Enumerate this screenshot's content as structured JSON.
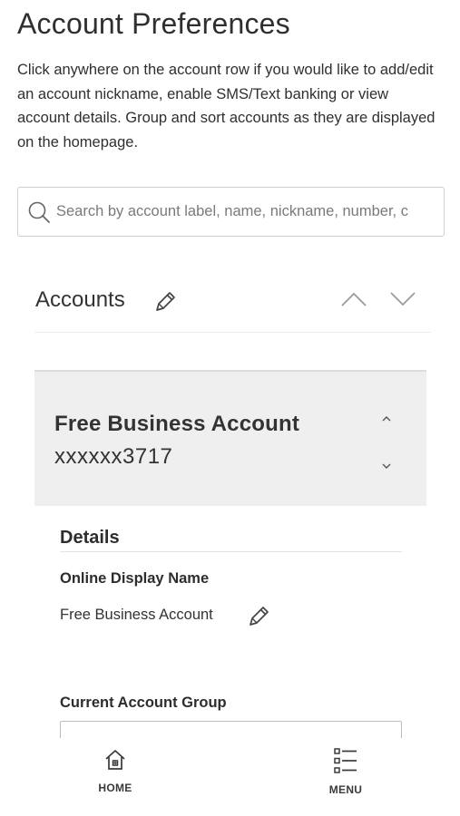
{
  "page": {
    "title": "Account Preferences",
    "intro": "Click anywhere on the account row if you would like to add/edit an account nickname, enable SMS/Text banking or view account details. Group and sort accounts as they are displayed on the homepage."
  },
  "search": {
    "placeholder": "Search by account label, name, nickname, number, c",
    "icon": "search-icon"
  },
  "accounts": {
    "heading": "Accounts",
    "edit_icon": "pencil-icon",
    "sort_up_icon": "chevron-up-icon",
    "sort_down_icon": "chevron-down-icon"
  },
  "account_card": {
    "name": "Free Business Account",
    "number": "xxxxxx3717",
    "move_up_icon": "caret-up-icon",
    "move_down_icon": "caret-down-icon"
  },
  "details": {
    "heading": "Details",
    "online_display_name_label": "Online Display Name",
    "online_display_name_value": "Free Business Account",
    "current_account_group_label": "Current Account Group",
    "current_account_group_value": ""
  },
  "bottom_nav": {
    "home_label": "HOME",
    "menu_label": "MENU",
    "home_icon": "home-icon",
    "menu_icon": "list-menu-icon"
  },
  "colors": {
    "card_background": "#efefef",
    "text": "#2f2f2f",
    "border": "#cfcfcf"
  }
}
